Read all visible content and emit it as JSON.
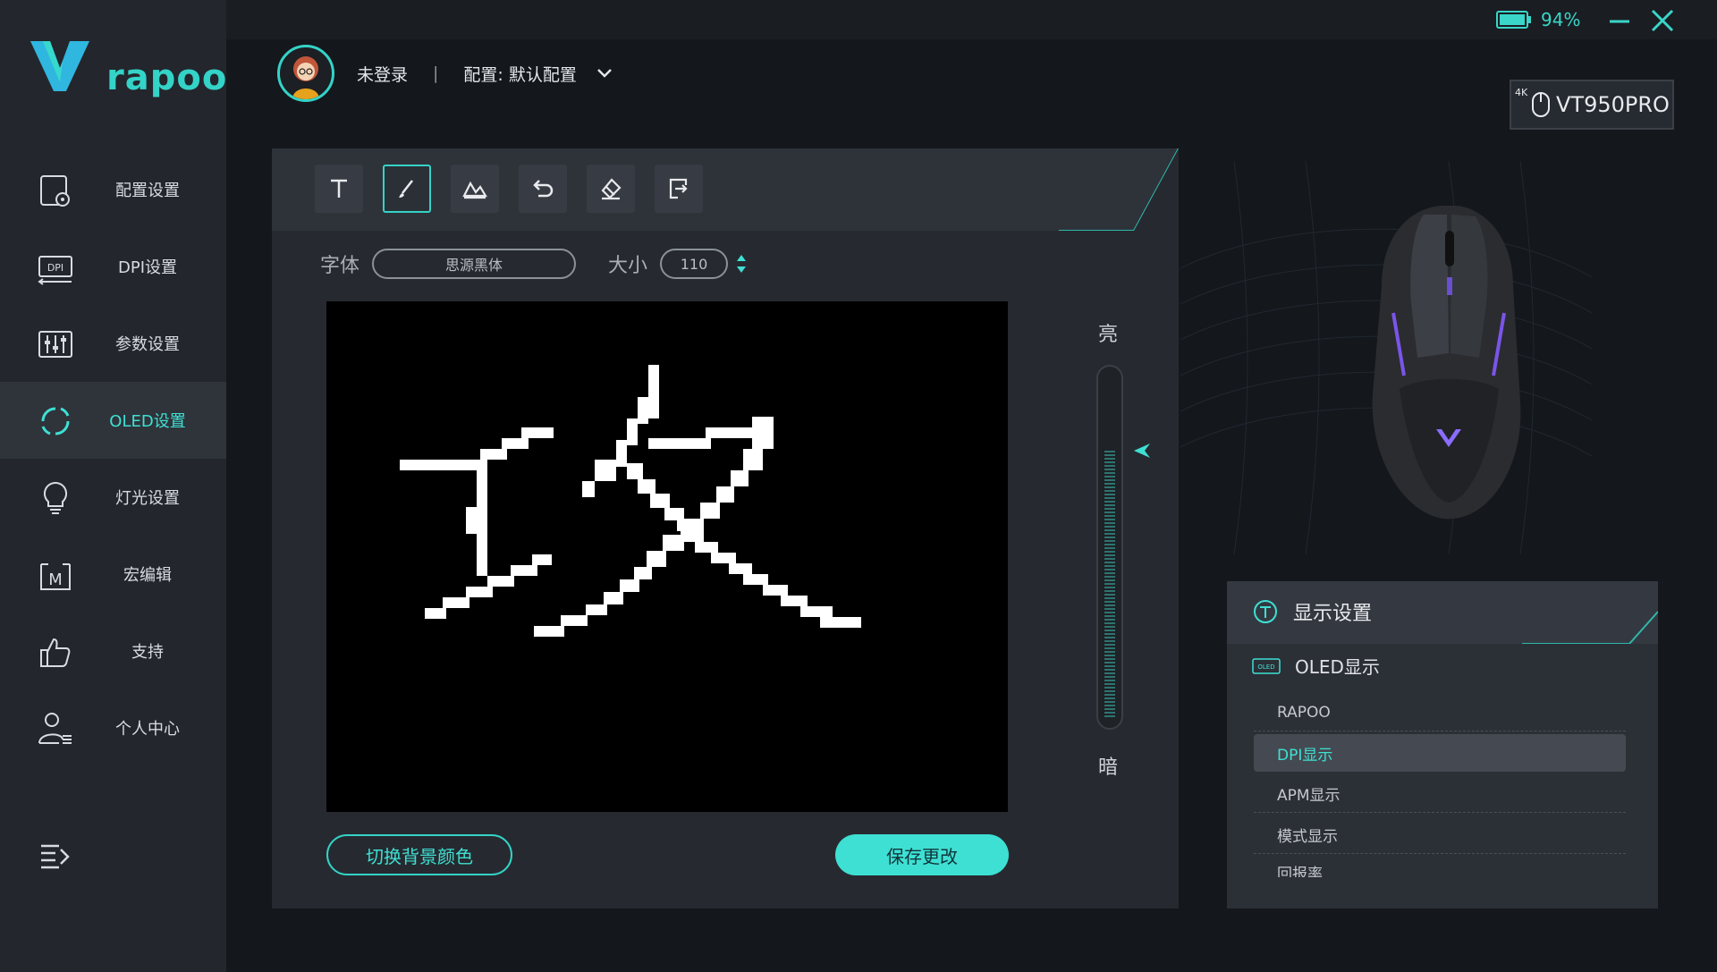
{
  "brand": {
    "logo_text": "rapoo"
  },
  "sidebar": {
    "items": [
      {
        "label": "配置设置",
        "icon": "profile-settings-icon"
      },
      {
        "label": "DPI设置",
        "icon": "dpi-icon"
      },
      {
        "label": "参数设置",
        "icon": "sliders-icon"
      },
      {
        "label": "OLED设置",
        "icon": "refresh-cycle-icon",
        "active": true
      },
      {
        "label": "灯光设置",
        "icon": "lightbulb-icon"
      },
      {
        "label": "宏编辑",
        "icon": "macro-icon"
      },
      {
        "label": "支持",
        "icon": "thumbs-up-icon"
      },
      {
        "label": "个人中心",
        "icon": "user-center-icon"
      }
    ],
    "menu_icon": "collapse-menu-icon"
  },
  "header": {
    "user_name": "未登录",
    "separator": "|",
    "profile_label": "配置: 默认配置",
    "battery_pct": "94%",
    "device_tag": "4K",
    "device_name": "VT950PRO"
  },
  "editor": {
    "tools": [
      "text-tool-icon",
      "brush-tool-icon",
      "image-tool-icon",
      "undo-icon",
      "eraser-icon",
      "export-icon"
    ],
    "active_tool": 1,
    "font_label": "字体",
    "font_value": "思源黑体",
    "size_label": "大小",
    "size_value": "110",
    "brightness_high": "亮",
    "brightness_low": "暗",
    "brightness_level": 0.78,
    "toggle_bg_button": "切换背景颜色",
    "save_button": "保存更改"
  },
  "display_settings": {
    "title": "显示设置",
    "oled_label": "OLED显示",
    "oled_tag": "OLED",
    "items": [
      {
        "label": "RAPOO"
      },
      {
        "label": "DPI显示",
        "active": true
      },
      {
        "label": "APM显示"
      },
      {
        "label": "模式显示"
      },
      {
        "label": "回报率"
      }
    ]
  },
  "colors": {
    "accent": "#3ee0d3",
    "bg": "#14171c",
    "sidebar": "#23262c"
  }
}
